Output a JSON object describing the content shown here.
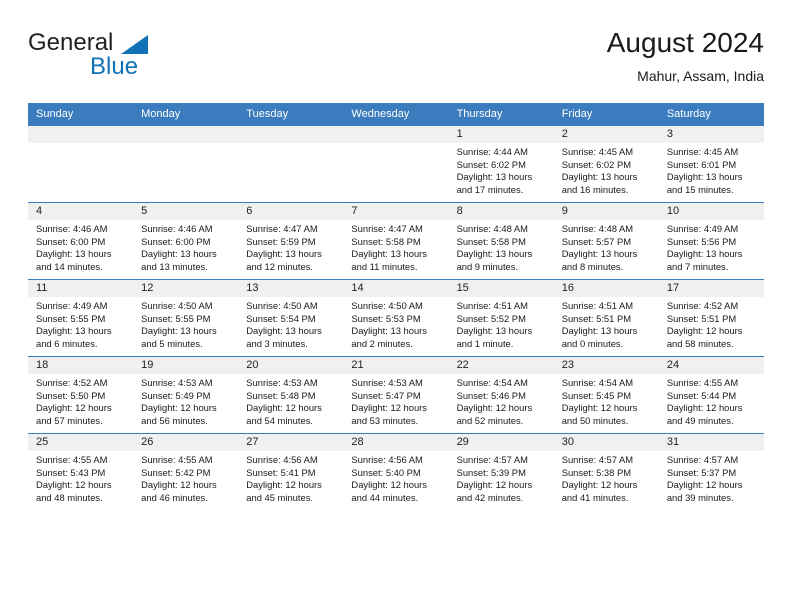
{
  "brand": {
    "name_part1": "General",
    "name_part2": "Blue",
    "triangle_color": "#1272b8"
  },
  "header": {
    "title": "August 2024",
    "subtitle": "Mahur, Assam, India"
  },
  "theme": {
    "header_blue": "#3a7cbd",
    "daynum_band": "#f0f0f0",
    "text": "#1a1a1a"
  },
  "weekday_headers": [
    "Sunday",
    "Monday",
    "Tuesday",
    "Wednesday",
    "Thursday",
    "Friday",
    "Saturday"
  ],
  "labels": {
    "sunrise_prefix": "Sunrise:",
    "sunset_prefix": "Sunset:",
    "daylight_prefix": "Daylight:"
  },
  "weeks": [
    [
      {
        "empty": true
      },
      {
        "empty": true
      },
      {
        "empty": true
      },
      {
        "empty": true
      },
      {
        "day": "1",
        "sunrise": "Sunrise: 4:44 AM",
        "sunset": "Sunset: 6:02 PM",
        "daylight_line1": "Daylight: 13 hours",
        "daylight_line2": "and 17 minutes."
      },
      {
        "day": "2",
        "sunrise": "Sunrise: 4:45 AM",
        "sunset": "Sunset: 6:02 PM",
        "daylight_line1": "Daylight: 13 hours",
        "daylight_line2": "and 16 minutes."
      },
      {
        "day": "3",
        "sunrise": "Sunrise: 4:45 AM",
        "sunset": "Sunset: 6:01 PM",
        "daylight_line1": "Daylight: 13 hours",
        "daylight_line2": "and 15 minutes."
      }
    ],
    [
      {
        "day": "4",
        "sunrise": "Sunrise: 4:46 AM",
        "sunset": "Sunset: 6:00 PM",
        "daylight_line1": "Daylight: 13 hours",
        "daylight_line2": "and 14 minutes."
      },
      {
        "day": "5",
        "sunrise": "Sunrise: 4:46 AM",
        "sunset": "Sunset: 6:00 PM",
        "daylight_line1": "Daylight: 13 hours",
        "daylight_line2": "and 13 minutes."
      },
      {
        "day": "6",
        "sunrise": "Sunrise: 4:47 AM",
        "sunset": "Sunset: 5:59 PM",
        "daylight_line1": "Daylight: 13 hours",
        "daylight_line2": "and 12 minutes."
      },
      {
        "day": "7",
        "sunrise": "Sunrise: 4:47 AM",
        "sunset": "Sunset: 5:58 PM",
        "daylight_line1": "Daylight: 13 hours",
        "daylight_line2": "and 11 minutes."
      },
      {
        "day": "8",
        "sunrise": "Sunrise: 4:48 AM",
        "sunset": "Sunset: 5:58 PM",
        "daylight_line1": "Daylight: 13 hours",
        "daylight_line2": "and 9 minutes."
      },
      {
        "day": "9",
        "sunrise": "Sunrise: 4:48 AM",
        "sunset": "Sunset: 5:57 PM",
        "daylight_line1": "Daylight: 13 hours",
        "daylight_line2": "and 8 minutes."
      },
      {
        "day": "10",
        "sunrise": "Sunrise: 4:49 AM",
        "sunset": "Sunset: 5:56 PM",
        "daylight_line1": "Daylight: 13 hours",
        "daylight_line2": "and 7 minutes."
      }
    ],
    [
      {
        "day": "11",
        "sunrise": "Sunrise: 4:49 AM",
        "sunset": "Sunset: 5:55 PM",
        "daylight_line1": "Daylight: 13 hours",
        "daylight_line2": "and 6 minutes."
      },
      {
        "day": "12",
        "sunrise": "Sunrise: 4:50 AM",
        "sunset": "Sunset: 5:55 PM",
        "daylight_line1": "Daylight: 13 hours",
        "daylight_line2": "and 5 minutes."
      },
      {
        "day": "13",
        "sunrise": "Sunrise: 4:50 AM",
        "sunset": "Sunset: 5:54 PM",
        "daylight_line1": "Daylight: 13 hours",
        "daylight_line2": "and 3 minutes."
      },
      {
        "day": "14",
        "sunrise": "Sunrise: 4:50 AM",
        "sunset": "Sunset: 5:53 PM",
        "daylight_line1": "Daylight: 13 hours",
        "daylight_line2": "and 2 minutes."
      },
      {
        "day": "15",
        "sunrise": "Sunrise: 4:51 AM",
        "sunset": "Sunset: 5:52 PM",
        "daylight_line1": "Daylight: 13 hours",
        "daylight_line2": "and 1 minute."
      },
      {
        "day": "16",
        "sunrise": "Sunrise: 4:51 AM",
        "sunset": "Sunset: 5:51 PM",
        "daylight_line1": "Daylight: 13 hours",
        "daylight_line2": "and 0 minutes."
      },
      {
        "day": "17",
        "sunrise": "Sunrise: 4:52 AM",
        "sunset": "Sunset: 5:51 PM",
        "daylight_line1": "Daylight: 12 hours",
        "daylight_line2": "and 58 minutes."
      }
    ],
    [
      {
        "day": "18",
        "sunrise": "Sunrise: 4:52 AM",
        "sunset": "Sunset: 5:50 PM",
        "daylight_line1": "Daylight: 12 hours",
        "daylight_line2": "and 57 minutes."
      },
      {
        "day": "19",
        "sunrise": "Sunrise: 4:53 AM",
        "sunset": "Sunset: 5:49 PM",
        "daylight_line1": "Daylight: 12 hours",
        "daylight_line2": "and 56 minutes."
      },
      {
        "day": "20",
        "sunrise": "Sunrise: 4:53 AM",
        "sunset": "Sunset: 5:48 PM",
        "daylight_line1": "Daylight: 12 hours",
        "daylight_line2": "and 54 minutes."
      },
      {
        "day": "21",
        "sunrise": "Sunrise: 4:53 AM",
        "sunset": "Sunset: 5:47 PM",
        "daylight_line1": "Daylight: 12 hours",
        "daylight_line2": "and 53 minutes."
      },
      {
        "day": "22",
        "sunrise": "Sunrise: 4:54 AM",
        "sunset": "Sunset: 5:46 PM",
        "daylight_line1": "Daylight: 12 hours",
        "daylight_line2": "and 52 minutes."
      },
      {
        "day": "23",
        "sunrise": "Sunrise: 4:54 AM",
        "sunset": "Sunset: 5:45 PM",
        "daylight_line1": "Daylight: 12 hours",
        "daylight_line2": "and 50 minutes."
      },
      {
        "day": "24",
        "sunrise": "Sunrise: 4:55 AM",
        "sunset": "Sunset: 5:44 PM",
        "daylight_line1": "Daylight: 12 hours",
        "daylight_line2": "and 49 minutes."
      }
    ],
    [
      {
        "day": "25",
        "sunrise": "Sunrise: 4:55 AM",
        "sunset": "Sunset: 5:43 PM",
        "daylight_line1": "Daylight: 12 hours",
        "daylight_line2": "and 48 minutes."
      },
      {
        "day": "26",
        "sunrise": "Sunrise: 4:55 AM",
        "sunset": "Sunset: 5:42 PM",
        "daylight_line1": "Daylight: 12 hours",
        "daylight_line2": "and 46 minutes."
      },
      {
        "day": "27",
        "sunrise": "Sunrise: 4:56 AM",
        "sunset": "Sunset: 5:41 PM",
        "daylight_line1": "Daylight: 12 hours",
        "daylight_line2": "and 45 minutes."
      },
      {
        "day": "28",
        "sunrise": "Sunrise: 4:56 AM",
        "sunset": "Sunset: 5:40 PM",
        "daylight_line1": "Daylight: 12 hours",
        "daylight_line2": "and 44 minutes."
      },
      {
        "day": "29",
        "sunrise": "Sunrise: 4:57 AM",
        "sunset": "Sunset: 5:39 PM",
        "daylight_line1": "Daylight: 12 hours",
        "daylight_line2": "and 42 minutes."
      },
      {
        "day": "30",
        "sunrise": "Sunrise: 4:57 AM",
        "sunset": "Sunset: 5:38 PM",
        "daylight_line1": "Daylight: 12 hours",
        "daylight_line2": "and 41 minutes."
      },
      {
        "day": "31",
        "sunrise": "Sunrise: 4:57 AM",
        "sunset": "Sunset: 5:37 PM",
        "daylight_line1": "Daylight: 12 hours",
        "daylight_line2": "and 39 minutes."
      }
    ]
  ]
}
